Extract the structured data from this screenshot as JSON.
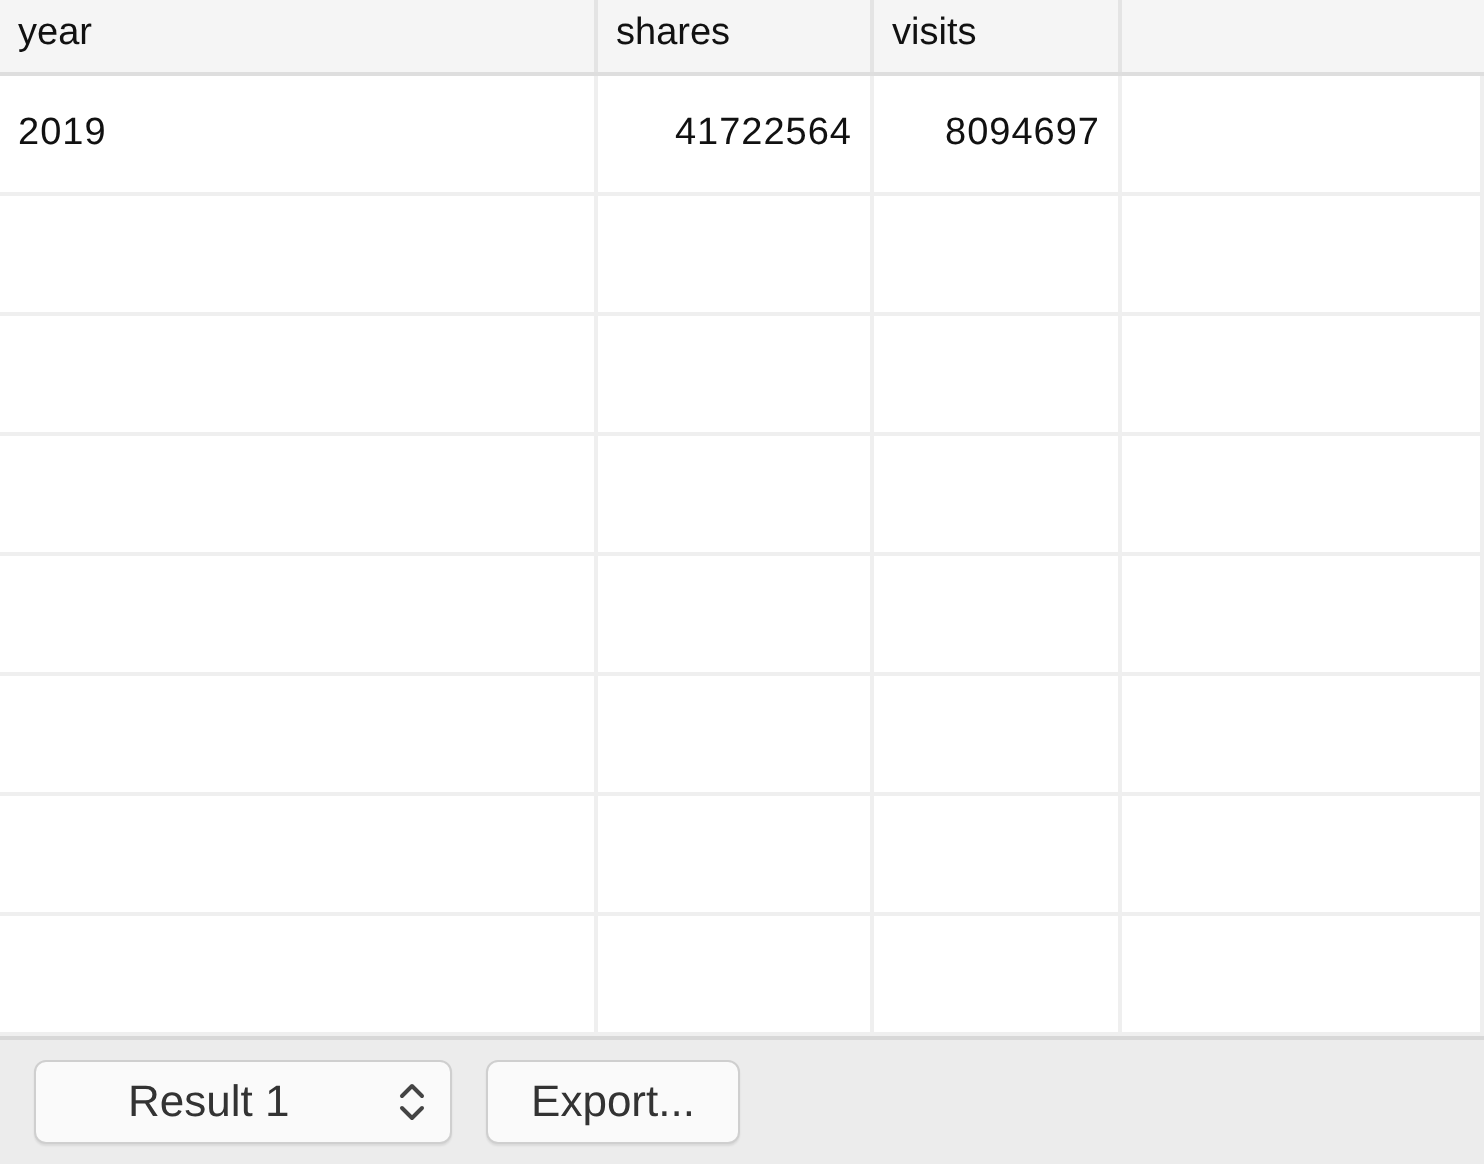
{
  "table": {
    "columns": [
      "year",
      "shares",
      "visits"
    ],
    "rows": [
      [
        "2019",
        "41722564",
        "8094697"
      ]
    ]
  },
  "footer": {
    "result_select": {
      "value": "Result 1"
    },
    "export_button": {
      "label": "Export..."
    }
  }
}
